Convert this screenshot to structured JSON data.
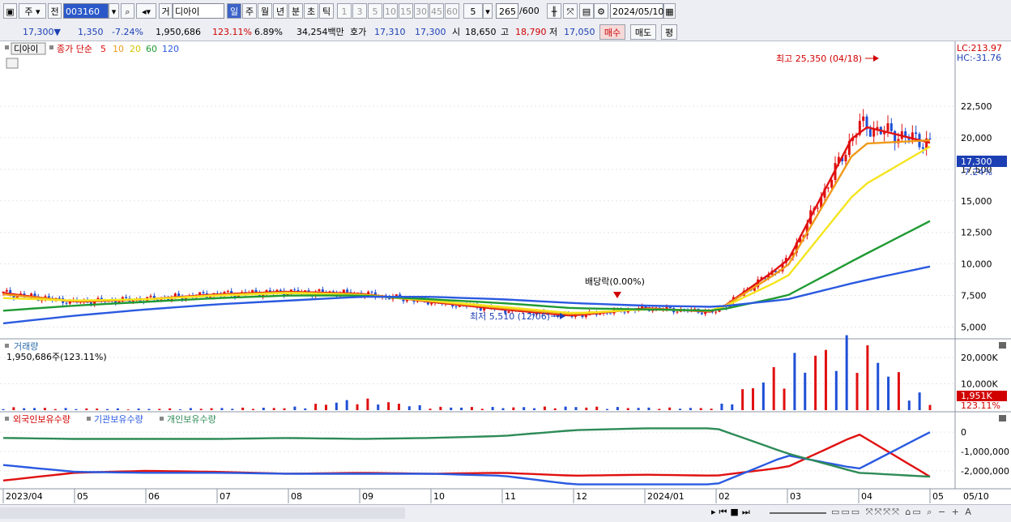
{
  "toolbar": {
    "mode_label": "주",
    "prev_label": "전",
    "code": "003160",
    "investor_label": "거",
    "name": "디아이",
    "periods": [
      "일",
      "주",
      "월",
      "년",
      "분",
      "초",
      "틱"
    ],
    "active_period": "일",
    "intervals": [
      "1",
      "3",
      "5",
      "10",
      "15",
      "30",
      "45",
      "60"
    ],
    "interval_value": "5",
    "count_value": "265",
    "count_max": "/600",
    "date": "2024/05/10"
  },
  "info": {
    "price": "17,300▼",
    "change": "1,350",
    "change_pct": "-7.24%",
    "volume": "1,950,686",
    "volume_ratio": "123.11%",
    "turnover": "6.89%",
    "amount": "34,254백만",
    "hoga_label": "호가",
    "hoga_ask": "17,310",
    "hoga_bid": "17,300",
    "open_label": "시",
    "open": "18,650",
    "high_label": "고",
    "high": "18,790",
    "low_label": "저",
    "low": "17,050",
    "buy_label": "매수",
    "sell_label": "매도",
    "avg_label": "평"
  },
  "price_panel": {
    "title": "디아이",
    "ma_label": "종가 단순",
    "ma_periods": [
      "5",
      "10",
      "20",
      "60",
      "120"
    ],
    "lc": "LC:213.97",
    "hc": "HC:-31.76",
    "current_tag": "17,300",
    "current_pct": "-7.24%",
    "max_annotation": "최고 25,350 (04/18)",
    "min_annotation": "최저 5,510 (12/06)",
    "dividend_annotation": "배당락(0.00%)"
  },
  "volume_panel": {
    "title": "거래량",
    "value": "1,950,686주(123.11%)",
    "tag": "1,951K",
    "tag_pct": "123.11%"
  },
  "holding_panel": {
    "foreign_label": "외국인보유수량",
    "inst_label": "기관보유수량",
    "indiv_label": "개인보유수량"
  },
  "colors": {
    "up": "#e01010",
    "down": "#1e4fd6",
    "ma5": "#e01010",
    "ma10": "#f09a1a",
    "ma20": "#f5e41e",
    "ma60": "#1f9a32",
    "ma120": "#2a5ae0",
    "foreign": "#e01010",
    "inst": "#2a5ae0",
    "indiv": "#2e8b57"
  },
  "chart_data": [
    {
      "type": "candlestick",
      "title": "디아이",
      "ylim": [
        4200,
        26800
      ],
      "y_ticks": [
        5000,
        7500,
        10000,
        12500,
        15000,
        17500,
        20000,
        22500
      ],
      "x_labels": [
        "2023/04",
        "05",
        "06",
        "07",
        "08",
        "09",
        "10",
        "11",
        "12",
        "2024/01",
        "02",
        "03",
        "04",
        "05",
        "05/10"
      ],
      "x": [
        "2023/04",
        "2023/05",
        "2023/06",
        "2023/07",
        "2023/08",
        "2023/09",
        "2023/10",
        "2023/11",
        "2023/12",
        "2024/01",
        "2024/02",
        "2024/03",
        "2024/04",
        "2024/05"
      ],
      "series": [
        {
          "name": "5",
          "values": [
            7700,
            7000,
            7200,
            7600,
            7800,
            7650,
            7000,
            6400,
            5900,
            6500,
            6200,
            10200,
            21000,
            19600
          ]
        },
        {
          "name": "10",
          "values": [
            7600,
            7050,
            7200,
            7550,
            7750,
            7600,
            7050,
            6500,
            6000,
            6450,
            6250,
            9800,
            19500,
            19800
          ]
        },
        {
          "name": "20",
          "values": [
            7300,
            7100,
            7200,
            7500,
            7700,
            7550,
            7100,
            6600,
            6100,
            6400,
            6300,
            9000,
            16000,
            19300
          ]
        },
        {
          "name": "60",
          "values": [
            6300,
            6700,
            7000,
            7300,
            7500,
            7500,
            7200,
            6900,
            6500,
            6400,
            6300,
            7500,
            10500,
            13400
          ]
        },
        {
          "name": "120",
          "values": [
            5300,
            5900,
            6400,
            6800,
            7100,
            7400,
            7400,
            7200,
            6900,
            6700,
            6600,
            7200,
            8600,
            9800
          ]
        }
      ],
      "annotations": [
        {
          "text": "최고 25,350 (04/18)",
          "x": "2024/04/18",
          "y": 25350
        },
        {
          "text": "최저 5,510 (12/06)",
          "x": "2023/12/06",
          "y": 5510
        }
      ]
    },
    {
      "type": "bar",
      "title": "거래량",
      "ylim": [
        0,
        24000
      ],
      "y_ticks": [
        10000,
        20000
      ],
      "y_tick_labels": [
        "10,000K",
        "20,000K"
      ],
      "x": [
        "2023/04",
        "2023/05",
        "2023/06",
        "2023/07",
        "2023/08",
        "2023/09",
        "2023/10",
        "2023/11",
        "2023/12",
        "2024/01",
        "2024/02",
        "2024/03",
        "2024/04",
        "2024/05"
      ],
      "values": [
        800,
        500,
        400,
        600,
        700,
        3200,
        900,
        800,
        1000,
        700,
        600,
        14000,
        20000,
        1951
      ]
    },
    {
      "type": "line",
      "title": "외국인보유수량 / 기관보유수량 / 개인보유수량",
      "ylim": [
        -2800000,
        300000
      ],
      "y_ticks": [
        0,
        -1000000,
        -2000000
      ],
      "y_tick_labels": [
        "0",
        "-1,000,000",
        "-2,000,000"
      ],
      "x": [
        "2023/04",
        "2023/05",
        "2023/06",
        "2023/07",
        "2023/08",
        "2023/09",
        "2023/10",
        "2023/11",
        "2023/12",
        "2024/01",
        "2024/02",
        "2024/03",
        "2024/04",
        "2024/05"
      ],
      "series": [
        {
          "name": "외국인보유수량",
          "values": [
            -2500000,
            -2100000,
            -2000000,
            -2050000,
            -2150000,
            -2100000,
            -2150000,
            -2100000,
            -2250000,
            -2200000,
            -2250000,
            -1800000,
            -100000,
            -2300000
          ]
        },
        {
          "name": "기관보유수량",
          "values": [
            -1700000,
            -2050000,
            -2100000,
            -2100000,
            -2150000,
            -2150000,
            -2150000,
            -2250000,
            -2700000,
            -2700000,
            -2700000,
            -1200000,
            -1900000,
            0
          ]
        },
        {
          "name": "개인보유수량",
          "values": [
            -300000,
            -350000,
            -350000,
            -350000,
            -300000,
            -350000,
            -300000,
            -200000,
            100000,
            200000,
            200000,
            -1100000,
            -2100000,
            -2300000
          ]
        }
      ]
    }
  ]
}
